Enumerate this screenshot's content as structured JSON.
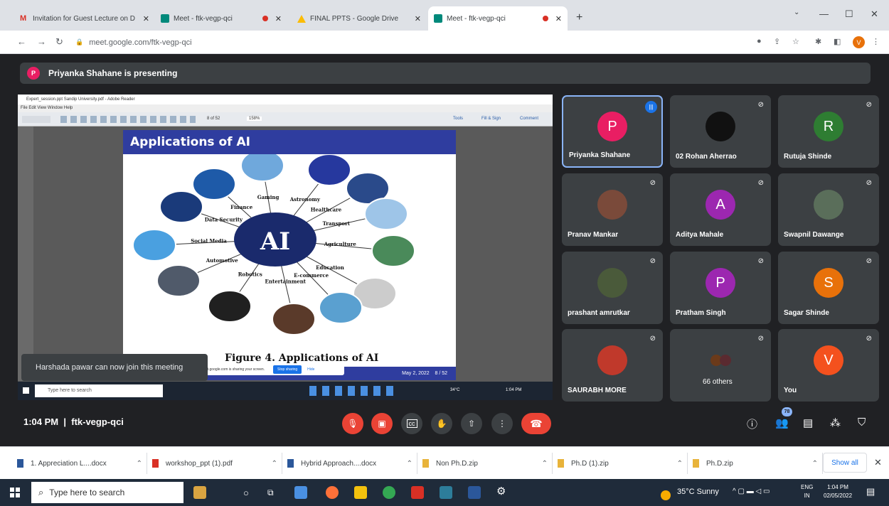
{
  "browser": {
    "tabs": [
      {
        "title": "Invitation for Guest Lecture on D",
        "favicon": "gmail-icon"
      },
      {
        "title": "Meet - ftk-vegp-qci",
        "favicon": "meet-icon"
      },
      {
        "title": "FINAL PPTS - Google Drive",
        "favicon": "drive-icon"
      },
      {
        "title": "Meet - ftk-vegp-qci",
        "favicon": "meet-icon"
      }
    ],
    "url": "meet.google.com/ftk-vegp-qci",
    "profile_initial": "V"
  },
  "meet": {
    "presenting_initial": "P",
    "presenting_text": "Priyanka Shahane is presenting",
    "meeting_time": "1:04 PM",
    "meeting_code": "ftk-vegp-qci",
    "participant_count": "78",
    "notification": "Harshada pawar can now join this meeting"
  },
  "shared_screen": {
    "reader_title": "Expert_session.ppt Sandip University.pdf - Adobe Reader",
    "reader_menu": "File  Edit  View  Window  Help",
    "reader_tools_right": [
      "Tools",
      "Fill & Sign",
      "Comment"
    ],
    "reader_zoom": "158%",
    "reader_page": "8 of 52",
    "slide_title": "Applications of AI",
    "slide_center": "AI",
    "slide_labels": [
      "Finance",
      "Gaming",
      "Astronomy",
      "Healthcare",
      "Transport",
      "Agriculture",
      "Education",
      "E-commerce",
      "Entertainment",
      "Robotics",
      "Automotive",
      "Social Media",
      "Data Security"
    ],
    "figure_caption": "Figure 4. Applications of AI",
    "slide_date": "May 2, 2022",
    "slide_page": "8 / 52",
    "share_notice": "meet.google.com is sharing your screen.",
    "stop_sharing": "Stop sharing",
    "hide": "Hide",
    "inner_search": "Type here to search",
    "inner_temp": "34°C",
    "inner_time": "1:04 PM"
  },
  "participants": [
    {
      "name": "Priyanka Shahane",
      "initial": "P",
      "color": "#e91e63",
      "type": "letter",
      "speaking": true
    },
    {
      "name": "02 Rohan Aherrao",
      "initial": "",
      "color": "#111111",
      "type": "logo"
    },
    {
      "name": "Rutuja Shinde",
      "initial": "R",
      "color": "#2e7d32",
      "type": "letter"
    },
    {
      "name": "Pranav Mankar",
      "initial": "",
      "color": "#7a4a3a",
      "type": "photo"
    },
    {
      "name": "Aditya Mahale",
      "initial": "A",
      "color": "#9c27b0",
      "type": "letter"
    },
    {
      "name": "Swapnil Dawange",
      "initial": "",
      "color": "#5a6e5a",
      "type": "photo"
    },
    {
      "name": "prashant amrutkar",
      "initial": "",
      "color": "#4a5a3a",
      "type": "photo"
    },
    {
      "name": "Pratham Singh",
      "initial": "P",
      "color": "#9c27b0",
      "type": "letter"
    },
    {
      "name": "Sagar Shinde",
      "initial": "S",
      "color": "#e8710a",
      "type": "letter"
    },
    {
      "name": "SAURABH MORE",
      "initial": "",
      "color": "#c0392b",
      "type": "photo"
    },
    {
      "name": "66 others",
      "initial": "",
      "color": "#3c4043",
      "type": "others"
    },
    {
      "name": "You",
      "initial": "V",
      "color": "#f4511e",
      "type": "letter"
    }
  ],
  "downloads": [
    {
      "name": "1. Appreciation L....docx",
      "kind": "docx"
    },
    {
      "name": "workshop_ppt (1).pdf",
      "kind": "pdf"
    },
    {
      "name": "Hybrid Approach....docx",
      "kind": "docx"
    },
    {
      "name": "Non Ph.D.zip",
      "kind": "zip"
    },
    {
      "name": "Ph.D (1).zip",
      "kind": "zip"
    },
    {
      "name": "Ph.D.zip",
      "kind": "zip"
    }
  ],
  "show_all": "Show all",
  "taskbar": {
    "search_placeholder": "Type here to search",
    "weather": "35°C  Sunny",
    "lang_top": "ENG",
    "lang_bottom": "IN",
    "time": "1:04 PM",
    "date": "02/05/2022"
  }
}
